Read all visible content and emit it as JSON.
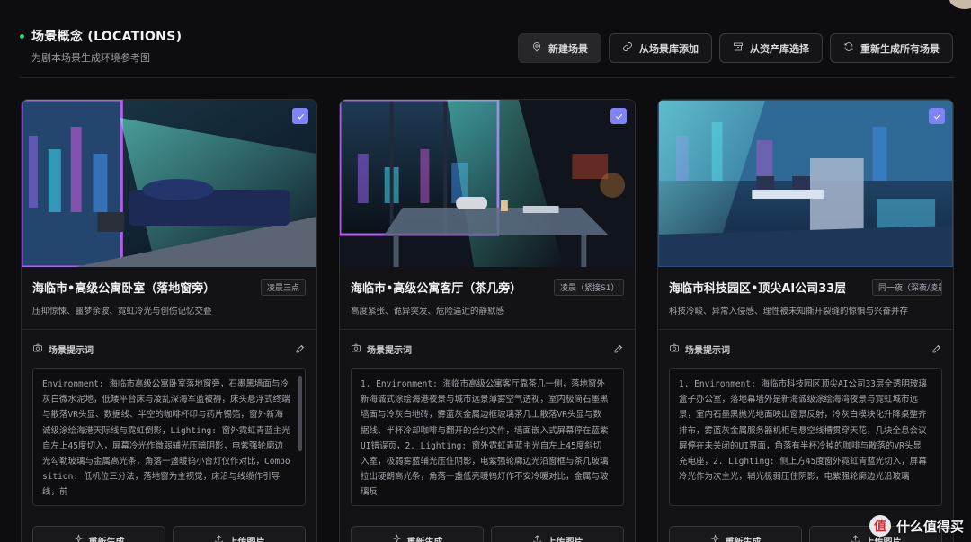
{
  "header": {
    "title": "场景概念 (LOCATIONS)",
    "subtitle": "为剧本场景生成环境参考图"
  },
  "toolbar": {
    "new_scene": "新建场景",
    "add_from_library": "从场景库添加",
    "select_from_assets": "从资产库选择",
    "regenerate_all": "重新生成所有场景"
  },
  "cards": [
    {
      "title": "海临市•高级公寓卧室（落地窗旁）",
      "badge": "凌晨三点",
      "desc": "压抑惊悚、噩梦余波、霓虹冷光与创伤记忆交叠",
      "prompt_label": "场景提示词",
      "prompt": "Environment: 海临市高级公寓卧室落地窗旁，石墨黑墙面与冷灰白微水泥地，低矮平台床与凌乱深海军蓝被褥，床头悬浮式终端与散落VR头显、数据线、半空的咖啡杯印与药片锡箔，窗外新海诚级涂绘海港天际线与霓虹倒影，Lighting: 窗外霓虹青蓝主光自左上45度切入，屏幕冷光作微弱辅光压暗阴影，电紫强轮廓边光勾勒玻璃与金属高光条，角落一盏暖钨小台灯仅作对比，Composition: 低机位三分法，落地窗为主视觉，床沿与线缆作引导线，前",
      "regen": "重新生成",
      "upload": "上传图片"
    },
    {
      "title": "海临市•高级公寓客厅（茶几旁）",
      "badge": "凌晨（紧接S1）",
      "desc": "高度紧张、诡异突发、危险逼近的静默感",
      "prompt_label": "场景提示词",
      "prompt": "1. Environment: 海临市高级公寓客厅靠茶几一侧，落地窗外新海诚式涂绘海港夜景与城市远景薄雾空气透视，室内极简石墨黑墙面与冷灰白地砖，雾蓝灰金属边框玻璃茶几上散落VR头显与数据线、半杯冷却咖啡与翻开的合约文件，墙面嵌入式屏幕停在蓝紫UI错误页，2. Lighting: 窗外霓虹青蓝主光自左上45度斜切入室，极弱雾蓝辅光压住阴影，电紫强轮廓边光沿窗框与茶几玻璃拉出硬朗高光条，角落一盏低亮暖钨灯作不安冷暖对比，金属与玻璃反",
      "regen": "重新生成",
      "upload": "上传图片"
    },
    {
      "title": "海临市科技园区•顶尖AI公司33层",
      "badge": "同一夜（深夜/凌晨",
      "desc": "科技冷峻、异常入侵感、理性被未知撕开裂缝的惊惧与兴奋并存",
      "prompt_label": "场景提示词",
      "prompt": "1. Environment: 海临市科技园区顶尖AI公司33层全透明玻璃盒子办公室，落地幕墙外是新海诚级涂绘海湾夜景与霓虹城市远景，室内石墨黑抛光地面映出窗景反射，冷灰白模块化升降桌整齐排布，雾蓝灰金属服务器机柜与悬空线槽贯穿天花，几块全息会议屏停在未关闭的UI界面，角落有半杯冷掉的咖啡与散落的VR头显充电座，2. Lighting: 侧上方45度窗外霓虹青蓝光切入，屏幕冷光作为次主光，辅光极弱压住阴影，电紫强轮廓边光沿玻璃",
      "regen": "重新生成",
      "upload": "上传图片"
    }
  ],
  "watermark": {
    "logo": "值",
    "text": "什么值得买"
  },
  "colors": {
    "accent_check": "#7f83f5",
    "status_dot": "#2fd07a",
    "background": "#0d0d0f"
  }
}
